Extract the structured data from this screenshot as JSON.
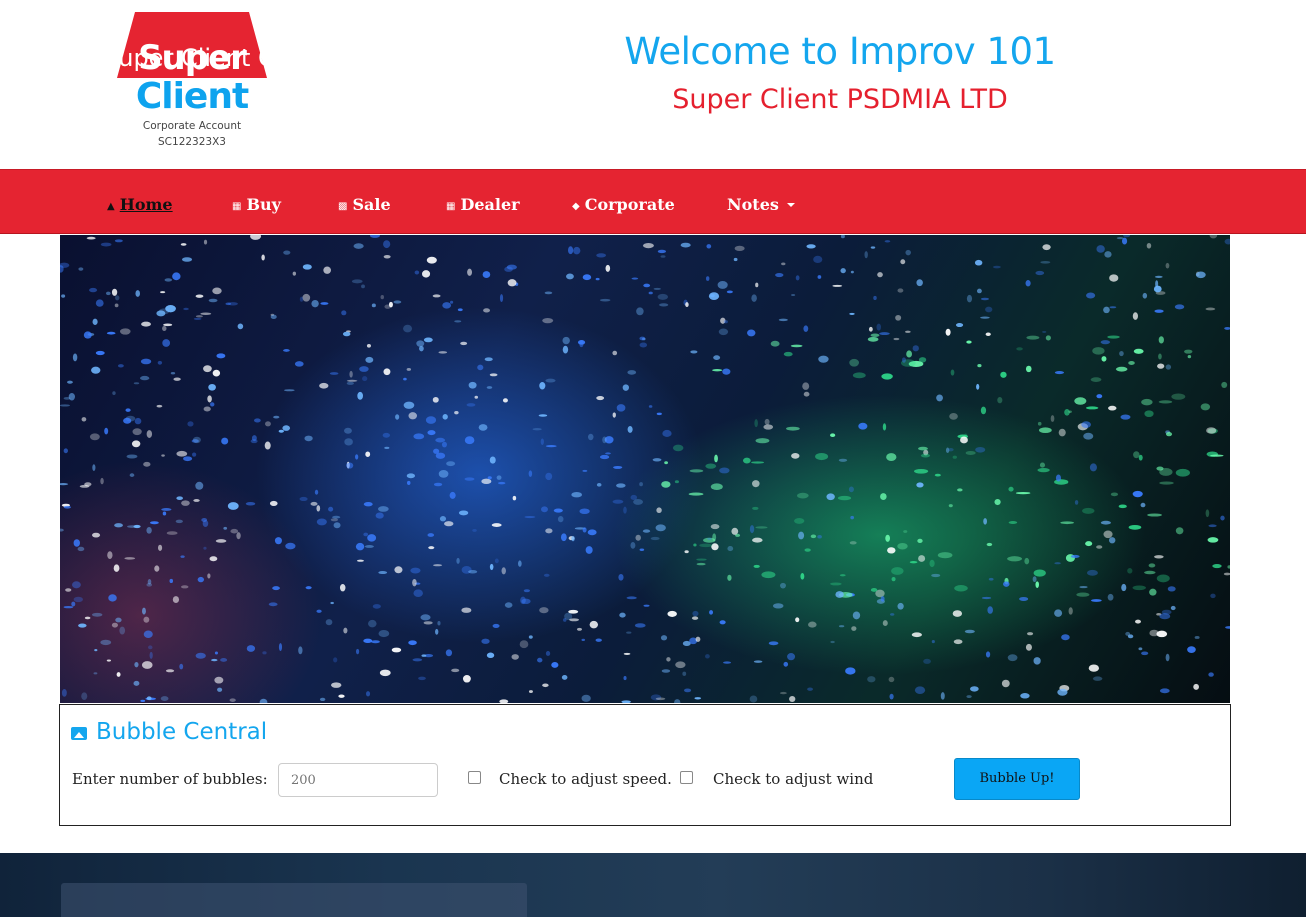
{
  "logo": {
    "word1": "Super",
    "word2": "Client",
    "sub1": "Corporate Account",
    "sub2": "SC122323X3"
  },
  "header": {
    "welcome": "Welcome to Improv 101",
    "company": "Super Client PSDMIA LTD"
  },
  "nav": {
    "items": [
      {
        "label": "Home",
        "icon": "home-icon",
        "active": true
      },
      {
        "label": "Buy",
        "icon": "calendar-icon"
      },
      {
        "label": "Sale",
        "icon": "chart-icon"
      },
      {
        "label": "Dealer",
        "icon": "calendar-icon"
      },
      {
        "label": "Corporate",
        "icon": "tag-icon"
      },
      {
        "label": "Notes",
        "icon": "caret-down-icon"
      }
    ]
  },
  "bubble": {
    "title": "Bubble Central",
    "count_label": "Enter number of bubbles:",
    "count_placeholder": "200",
    "speed_label": "Check to adjust speed.",
    "wind_label": "Check to adjust wind",
    "button": "Bubble Up!"
  },
  "footer": {
    "title": "Super Client Company LTD"
  },
  "colors": {
    "brand_red": "#e52431",
    "brand_blue": "#14a6ee"
  }
}
